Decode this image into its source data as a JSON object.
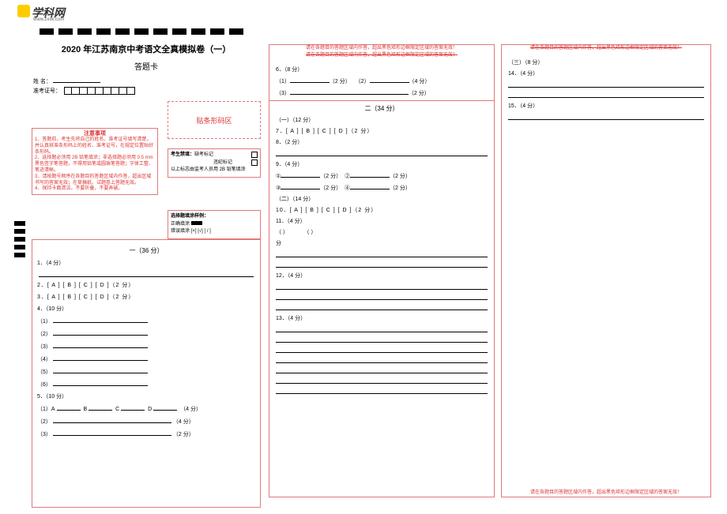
{
  "logo": {
    "text": "学科网",
    "url": "www.zxxk.com"
  },
  "exam_title": "2020 年江苏南京中考语文全真模拟卷（一）",
  "card_title": "答题卡",
  "labels": {
    "name": "姓  名：",
    "id": "准考证号：",
    "barcode": "贴条形码区"
  },
  "notice": {
    "header": "注意事项",
    "items": [
      "1．答题前，考生先将自己的姓名、准考证号填写清楚，并认真核准条形码上的姓名、准考证号，在规定位置贴好条形码。",
      "2．选择题必须用 2B 铅笔填涂；非选择题必须用 0.5 mm 黑色签字笔答题，不得用铅笔或圆珠笔答题；字体工整、笔迹清晰。",
      "3．请按题号顺序在各题目的答题区域内作答，超出区域书写的答案无效；在草稿纸、试题卷上答题无效。",
      "4．保持卡面清洁，不要折叠，不要弄破。"
    ]
  },
  "marks": {
    "title": "考生禁填：",
    "miss": "缺考标记",
    "viol": "违纪标记",
    "note": "以上标志由监考人员用 2B 铅笔填涂"
  },
  "sample": {
    "title": "选择题填涂样例：",
    "correct": "正确填涂",
    "wrong": "错误填涂",
    "wrong_ex": "[×]  [√]  [ / ]"
  },
  "warn_top": "请在各题目的答题区域内作答，超出黑色矩形边框限定区域的答案无效！",
  "warn_top_strike": "请在各题目的答题区域内作答，超出黑色矩形边框限定区域的答案无效！",
  "warn_top_3": "请在各题目的答题区域内作答，超出黑色矩形边框限定区域的答案无效！",
  "warn_bot": "请在各题目的答题区域内作答，超出黑色矩形边框限定区域的答案无效！",
  "section1": {
    "title": "一（36 分）",
    "q1": "1．（4 分）",
    "q2": "2．[ A ] [ B ] [ C ] [ D ]（2 分）",
    "q3": "3．[ A ] [ B ] [ C ] [ D ]（2 分）",
    "q4": "4．（10 分）",
    "q4_sub": [
      "（1）",
      "（2）",
      "（3）",
      "（4）",
      "（5）",
      "（6）"
    ],
    "q5": "5．（10 分）",
    "q5_labels": {
      "a": "（1）A",
      "b": "B",
      "c": "C",
      "d": "D",
      "pts1": "（4 分）",
      "l2": "（2）",
      "pts2": "（4 分）",
      "l3": "（3）",
      "pts3": "（2 分）"
    }
  },
  "p2": {
    "q6": "6．（8 分）",
    "q6_1": "（1）",
    "q6_2": "（2 分）",
    "q6_3": "（2）",
    "q6_4": "（4 分）",
    "q6_5": "（3）",
    "q6_6": "（2 分）",
    "sec2": "二（34 分）",
    "sub1": "（一）（12 分）",
    "q7": "7．[ A ] [ B ] [ C ] [ D ]（2 分）",
    "q8": "8．（2 分）",
    "q9": "9．（4 分）",
    "q9_1": "①",
    "q9_1p": "（2 分）",
    "q9_2": "②",
    "q9_2p": "（2 分）",
    "q9_3": "③",
    "q9_3p": "（2 分）",
    "q9_4": "④",
    "q9_4p": "（2 分）",
    "sub2": "（二）（14 分）",
    "q10": "10．[ A ] [ B ] [ C ] [ D ]（2 分）",
    "q11": "11．（4 分）",
    "q11_a": "（    ）",
    "q11_b": "（    ）",
    "fen": "分",
    "q12": "12．（4 分）",
    "q13": "13．（4 分）"
  },
  "p3": {
    "sub3": "（三）（8 分）",
    "q14": "14．（4 分）",
    "q15": "15．（4 分）"
  }
}
